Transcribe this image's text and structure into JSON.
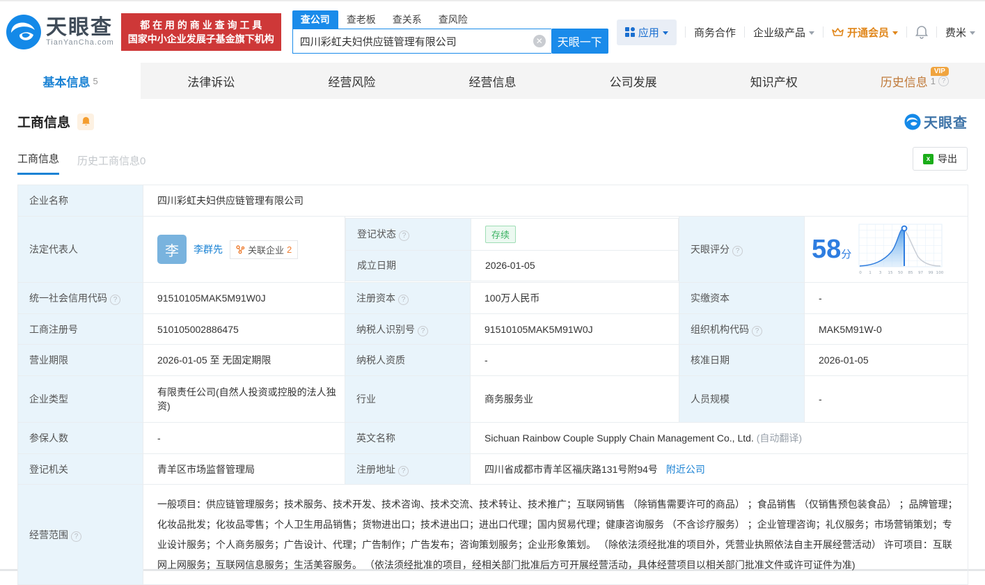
{
  "colors": {
    "accent_blue": "#1a82d4",
    "button_blue": "#1a8bea",
    "banner_red": "#ce3838",
    "vip_orange": "#e0861a",
    "badge_orange": "#f0a43e",
    "status_green": "#3bb263",
    "label_cell_bg": "#e9f4fb",
    "score_blue": "#2e7de0"
  },
  "header": {
    "brand": {
      "name": "天眼查",
      "domain": "TianYanCha.com"
    },
    "slogan": {
      "line1": "都 在 用 的 商 业 查 询 工 具",
      "line2": "国家中小企业发展子基金旗下机构"
    },
    "search": {
      "tabs": [
        {
          "label": "查公司"
        },
        {
          "label": "查老板"
        },
        {
          "label": "查关系"
        },
        {
          "label": "查风险"
        }
      ],
      "value": "四川彩虹夫妇供应链管理有限公司",
      "button": "天眼一下"
    },
    "nav": {
      "apps": "应用",
      "biz": "商务合作",
      "enterprise": "企业级产品",
      "vip": "开通会员",
      "user": "费米"
    }
  },
  "tabs": [
    {
      "label": "基本信息",
      "count": "5"
    },
    {
      "label": "法律诉讼"
    },
    {
      "label": "经营风险"
    },
    {
      "label": "经营信息"
    },
    {
      "label": "公司发展"
    },
    {
      "label": "知识产权"
    },
    {
      "label": "历史信息",
      "count": "1",
      "badge": "VIP"
    }
  ],
  "section": {
    "title": "工商信息",
    "watermark": "天眼查",
    "subtab_active": "工商信息",
    "subtab_history": "历史工商信息0",
    "export_label": "导出"
  },
  "fields": {
    "name": {
      "label": "企业名称",
      "value": "四川彩虹夫妇供应链管理有限公司"
    },
    "legal": {
      "label": "法定代表人",
      "avatar": "李",
      "person": "李群先",
      "related_label": "关联企业",
      "related_count": "2"
    },
    "reg_status": {
      "label": "登记状态",
      "value": "存续"
    },
    "est_date": {
      "label": "成立日期",
      "value": "2026-01-05"
    },
    "score": {
      "label": "天眼评分",
      "value": "58",
      "unit": "分"
    },
    "credit_code": {
      "label": "统一社会信用代码",
      "value": "91510105MAK5M91W0J"
    },
    "reg_capital": {
      "label": "注册资本",
      "value": "100万人民币"
    },
    "paid_capital": {
      "label": "实缴资本",
      "value": "-"
    },
    "reg_number": {
      "label": "工商注册号",
      "value": "510105002886475"
    },
    "taxpayer_id": {
      "label": "纳税人识别号",
      "value": "91510105MAK5M91W0J"
    },
    "org_code": {
      "label": "组织机构代码",
      "value": "MAK5M91W-0"
    },
    "business_term": {
      "label": "营业期限",
      "value": "2026-01-05 至 无固定期限"
    },
    "taxpayer_quality": {
      "label": "纳税人资质",
      "value": "-"
    },
    "approval_date": {
      "label": "核准日期",
      "value": "2026-01-05"
    },
    "company_type": {
      "label": "企业类型",
      "value": "有限责任公司(自然人投资或控股的法人独资)"
    },
    "industry": {
      "label": "行业",
      "value": "商务服务业"
    },
    "staff_size": {
      "label": "人员规模",
      "value": "-"
    },
    "insured_count": {
      "label": "参保人数",
      "value": "-"
    },
    "english_name": {
      "label": "英文名称",
      "value": "Sichuan Rainbow Couple Supply Chain Management Co., Ltd.",
      "note": "(自动翻译)"
    },
    "reg_authority": {
      "label": "登记机关",
      "value": "青羊区市场监督管理局"
    },
    "reg_address": {
      "label": "注册地址",
      "value": "四川省成都市青羊区福庆路131号附94号",
      "link": "附近公司"
    },
    "business_scope": {
      "label": "经营范围",
      "value": "一般项目：供应链管理服务；技术服务、技术开发、技术咨询、技术交流、技术转让、技术推广；互联网销售 （除销售需要许可的商品） ；食品销售 （仅销售预包装食品） ；品牌管理；化妆品批发；化妆品零售；个人卫生用品销售；货物进出口；技术进出口；进出口代理；国内贸易代理；健康咨询服务 （不含诊疗服务） ；企业管理咨询；礼仪服务；市场营销策划；专业设计服务；个人商务服务；广告设计、代理；广告制作；广告发布；咨询策划服务；企业形象策划。 （除依法须经批准的项目外，凭营业执照依法自主开展经营活动） 许可项目：互联网上网服务；互联网信息服务；生活美容服务。 （依法须经批准的项目，经相关部门批准后方可开展经营活动，具体经营项目以相关部门批准文件或许可证件为准)"
    }
  },
  "chart_data": {
    "type": "area",
    "title": "天眼评分分布曲线",
    "curve": "bell",
    "score_marker": 58,
    "x_ticks": [
      "0",
      "1",
      "3",
      "15",
      "50",
      "85",
      "97",
      "99",
      "100"
    ],
    "highlight_color": "#2e7de0",
    "rest_color": "#c9ced6",
    "grid": true
  }
}
